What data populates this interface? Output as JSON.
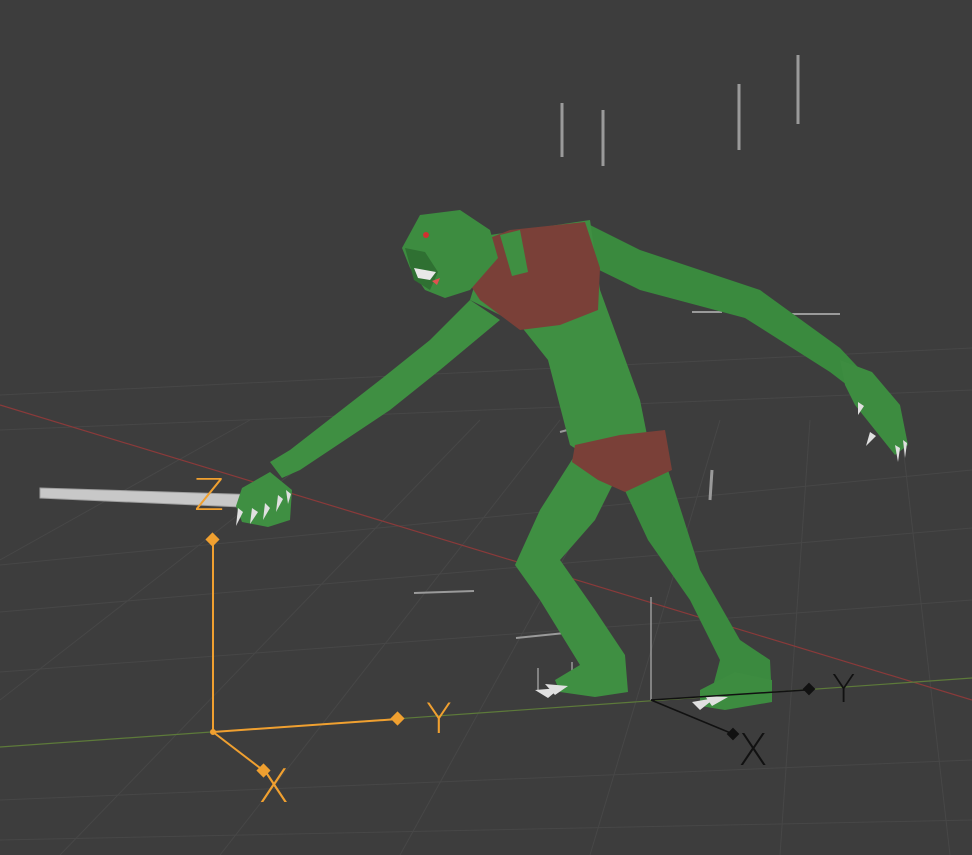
{
  "viewport": {
    "colors": {
      "background": "#3d3d3d",
      "grid": "#474747",
      "x_axis": "#8a3a3a",
      "y_axis": "#5d7a3a",
      "selected_gizmo": "#f0a030",
      "goblin_skin": "#3d8c40",
      "goblin_cloth": "#7a4038",
      "bone_marker": "#9a9a9a"
    }
  },
  "gizmos": {
    "selected_empty": {
      "state": "selected",
      "icon": "axis-gizmo-icon",
      "labels": {
        "x": "X",
        "y": "Y",
        "z": "Z"
      }
    },
    "armature_empty": {
      "state": "unselected",
      "icon": "axis-gizmo-icon",
      "labels": {
        "x": "X",
        "y": "Y"
      }
    }
  },
  "model": {
    "icon": "goblin-mesh-icon",
    "held_object": "spear-icon"
  }
}
